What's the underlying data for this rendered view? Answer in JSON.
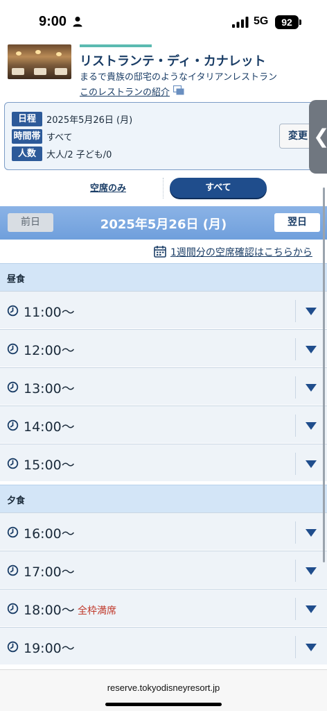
{
  "status_bar": {
    "time": "9:00",
    "network": "5G",
    "battery": "92"
  },
  "restaurant": {
    "name": "リストランテ・ディ・カナレット",
    "description": "まるで貴族の邸宅のようなイタリアンレストラン",
    "intro_link": "このレストランの紹介"
  },
  "conditions": {
    "date_tag": "日程",
    "date_value": "2025年5月26日 (月)",
    "time_tag": "時間帯",
    "time_value": "すべて",
    "people_tag": "人数",
    "people_value": "大人/2 子ども/0",
    "change_label": "変更",
    "side_tab_glyph": "❮"
  },
  "filters": {
    "vacancy_only": "空席のみ",
    "all": "すべて",
    "selected": "all"
  },
  "date_nav": {
    "prev": "前日",
    "current": "2025年5月26日 (月)",
    "next": "翌日"
  },
  "week_link": "1週間分の空席確認はこちらから",
  "sections": [
    {
      "title": "昼食",
      "slots": [
        {
          "time": "11:00〜",
          "status": ""
        },
        {
          "time": "12:00〜",
          "status": ""
        },
        {
          "time": "13:00〜",
          "status": ""
        },
        {
          "time": "14:00〜",
          "status": ""
        },
        {
          "time": "15:00〜",
          "status": ""
        }
      ]
    },
    {
      "title": "夕食",
      "slots": [
        {
          "time": "16:00〜",
          "status": ""
        },
        {
          "time": "17:00〜",
          "status": ""
        },
        {
          "time": "18:00〜",
          "status": "全枠満席"
        },
        {
          "time": "19:00〜",
          "status": ""
        }
      ]
    }
  ],
  "browser": {
    "url": "reserve.tokyodisneyresort.jp"
  },
  "colors": {
    "primary": "#1f4d8c",
    "date_bar": "#7aa7e0",
    "section_bg": "#d3e5f7",
    "full_text": "#c0392b",
    "accent": "#5bbab1"
  }
}
